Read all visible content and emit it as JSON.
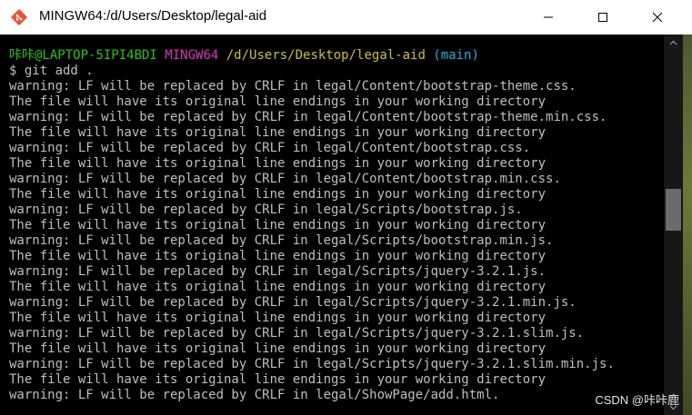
{
  "window": {
    "title": "MINGW64:/d/Users/Desktop/legal-aid"
  },
  "prompt": {
    "user": "咔咔@LAPTOP-5IPI4BDI",
    "host": "MINGW64",
    "path": "/d/Users/Desktop/legal-aid",
    "branch": "(main)",
    "command": "$ git add ."
  },
  "output": [
    "warning: LF will be replaced by CRLF in legal/Content/bootstrap-theme.css.",
    "The file will have its original line endings in your working directory",
    "warning: LF will be replaced by CRLF in legal/Content/bootstrap-theme.min.css.",
    "The file will have its original line endings in your working directory",
    "warning: LF will be replaced by CRLF in legal/Content/bootstrap.css.",
    "The file will have its original line endings in your working directory",
    "warning: LF will be replaced by CRLF in legal/Content/bootstrap.min.css.",
    "The file will have its original line endings in your working directory",
    "warning: LF will be replaced by CRLF in legal/Scripts/bootstrap.js.",
    "The file will have its original line endings in your working directory",
    "warning: LF will be replaced by CRLF in legal/Scripts/bootstrap.min.js.",
    "The file will have its original line endings in your working directory",
    "warning: LF will be replaced by CRLF in legal/Scripts/jquery-3.2.1.js.",
    "The file will have its original line endings in your working directory",
    "warning: LF will be replaced by CRLF in legal/Scripts/jquery-3.2.1.min.js.",
    "The file will have its original line endings in your working directory",
    "warning: LF will be replaced by CRLF in legal/Scripts/jquery-3.2.1.slim.js.",
    "The file will have its original line endings in your working directory",
    "warning: LF will be replaced by CRLF in legal/Scripts/jquery-3.2.1.slim.min.js.",
    "The file will have its original line endings in your working directory",
    "warning: LF will be replaced by CRLF in legal/ShowPage/add.html."
  ],
  "watermark": "CSDN @咔咔鹿",
  "colors": {
    "prompt_user": "#19cb00",
    "prompt_host": "#e22ec0",
    "prompt_path": "#cbc600",
    "prompt_branch": "#0bb4e4",
    "terminal_text": "#bfbfbf",
    "terminal_bg": "#000000"
  },
  "icons": {
    "app": "git-icon",
    "minimize": "minimize-icon",
    "maximize": "maximize-icon",
    "close": "close-icon"
  }
}
